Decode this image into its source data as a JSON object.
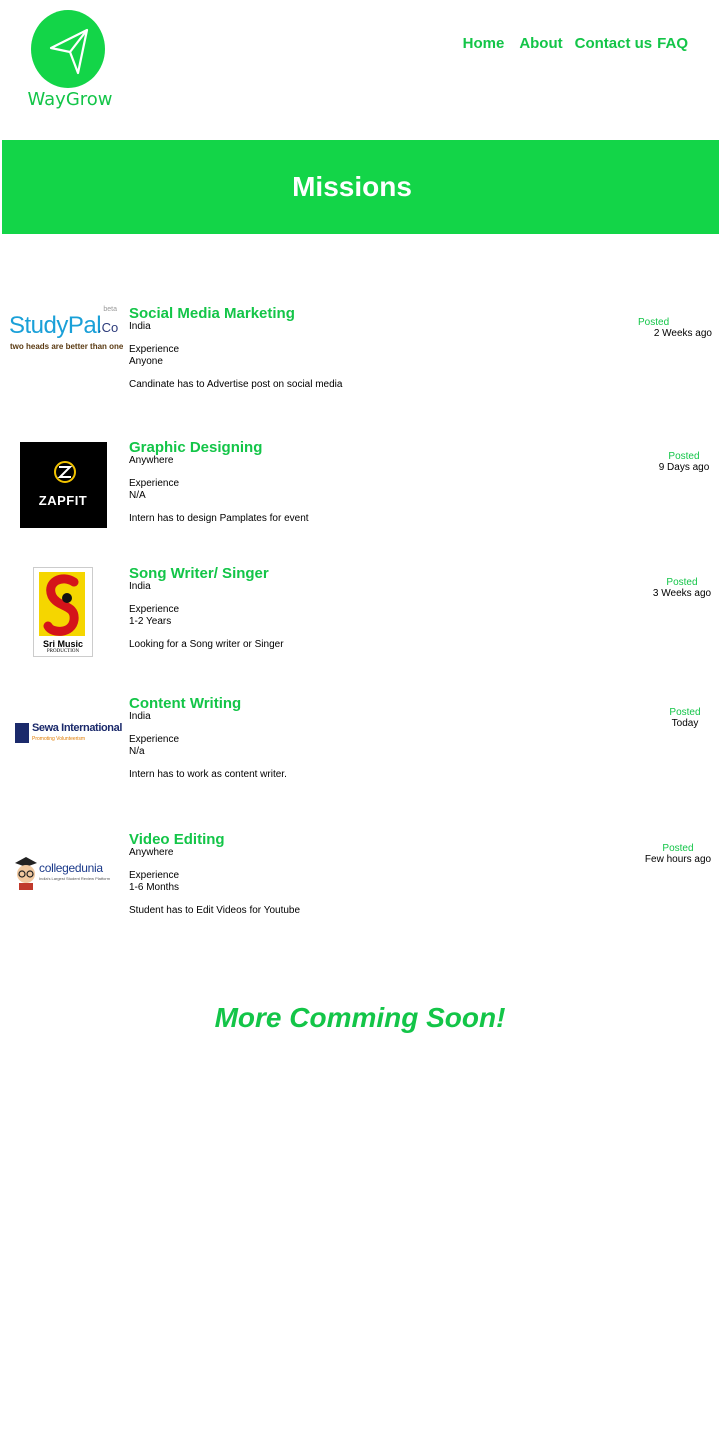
{
  "brand": {
    "name": "WayGrow",
    "color": "#13d548",
    "logo_icon": "paper-plane-icon"
  },
  "nav": {
    "home": "Home",
    "about": "About",
    "contact": "Contact us",
    "faq": "FAQ"
  },
  "banner": {
    "title": "Missions"
  },
  "missions": [
    {
      "company": "StudyPal.co",
      "logo_text": "StudyPal",
      "logo_suffix": ".Co",
      "logo_badge": "beta",
      "logo_tagline": "two heads are better than one",
      "title": "Social Media Marketing",
      "location": "India",
      "experience_label": "Experience",
      "experience": "Anyone",
      "description": "Candinate has to Advertise post on social media",
      "posted_label": "Posted",
      "posted": "2 Weeks ago"
    },
    {
      "company": "ZapFit",
      "logo_text": "ZAPFIT",
      "title": "Graphic Designing",
      "location": "Anywhere",
      "experience_label": "Experience",
      "experience": "N/A",
      "description": "Intern has to design Pamplates for event",
      "posted_label": "Posted",
      "posted": "9 Days ago"
    },
    {
      "company": "Sri Music Production",
      "logo_text": "Sri Music",
      "logo_tagline": "PRODUCTION",
      "title": "Song Writer/ Singer",
      "location": "India",
      "experience_label": "Experience",
      "experience": "1-2 Years",
      "description": "Looking for a Song writer or Singer",
      "posted_label": "Posted",
      "posted": "3 Weeks ago"
    },
    {
      "company": "Sewa International",
      "logo_text": "Sewa International",
      "logo_tagline": "Promoting Volunteerism",
      "title": "Content Writing",
      "location": "India",
      "experience_label": "Experience",
      "experience": "N/a",
      "description": "Intern has to work as content writer.",
      "posted_label": "Posted",
      "posted": "Today"
    },
    {
      "company": "collegedunia",
      "logo_text": "collegedunia",
      "logo_tagline": "India's Largest Student Review Platform",
      "title": "Video Editing",
      "location": "Anywhere",
      "experience_label": "Experience",
      "experience": "1-6 Months",
      "description": "Student has to Edit Videos for Youtube",
      "posted_label": "Posted",
      "posted": "Few hours ago"
    }
  ],
  "footer": {
    "coming_soon": "More Comming Soon!"
  }
}
